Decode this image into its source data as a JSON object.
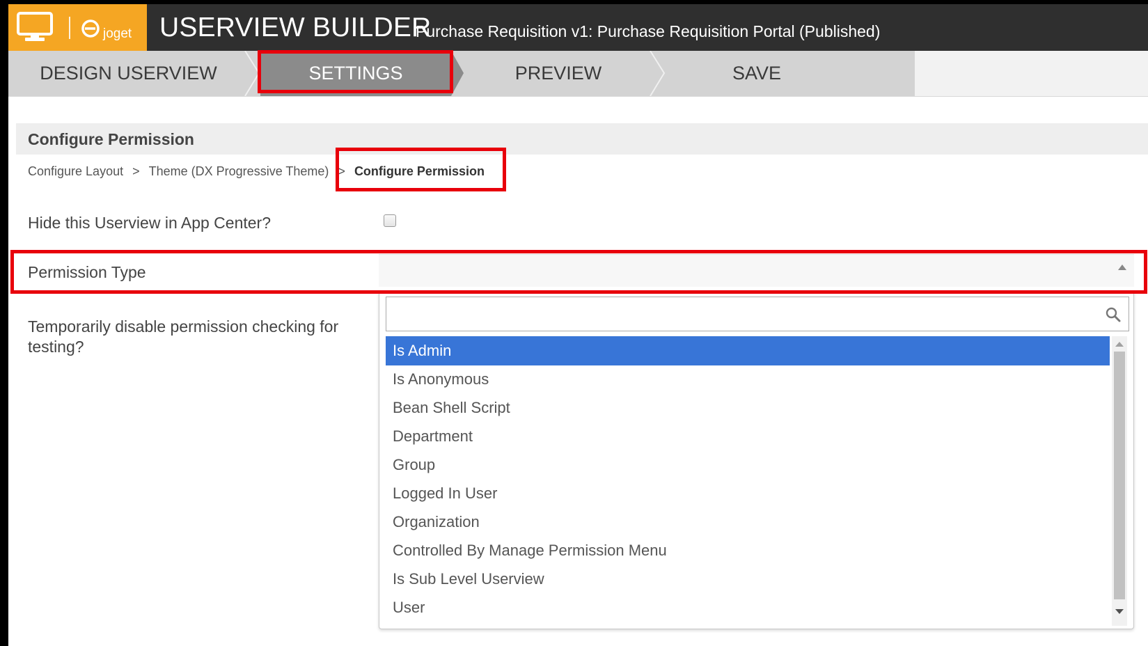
{
  "header": {
    "title": "USERVIEW BUILDER",
    "subtitle": "Purchase Requisition v1: Purchase Requisition Portal (Published)",
    "logo_text": "joget",
    "logo_color": "#f5a623",
    "bar_color": "#2f2f2f"
  },
  "tabs": [
    {
      "label": "DESIGN USERVIEW",
      "active": false
    },
    {
      "label": "SETTINGS",
      "active": true
    },
    {
      "label": "PREVIEW",
      "active": false
    },
    {
      "label": "SAVE",
      "active": false
    }
  ],
  "section": {
    "title": "Configure Permission"
  },
  "breadcrumb": {
    "items": [
      "Configure Layout",
      "Theme (DX Progressive Theme)",
      "Configure Permission"
    ],
    "separator": ">"
  },
  "fields": {
    "hide_userview": {
      "label": "Hide this Userview in App Center?",
      "checked": false
    },
    "permission_type": {
      "label": "Permission Type",
      "value": ""
    },
    "disable_permission": {
      "label": "Temporarily disable permission checking for testing?"
    }
  },
  "dropdown": {
    "search_value": "",
    "options": [
      {
        "label": "Is Admin",
        "selected": true
      },
      {
        "label": "Is Anonymous",
        "selected": false
      },
      {
        "label": "Bean Shell Script",
        "selected": false
      },
      {
        "label": "Department",
        "selected": false
      },
      {
        "label": "Group",
        "selected": false
      },
      {
        "label": "Logged In User",
        "selected": false
      },
      {
        "label": "Organization",
        "selected": false
      },
      {
        "label": "Controlled By Manage Permission Menu",
        "selected": false
      },
      {
        "label": "Is Sub Level Userview",
        "selected": false
      },
      {
        "label": "User",
        "selected": false
      }
    ],
    "selected_color": "#3875d7"
  },
  "highlight_color": "#e8000b",
  "icons": {
    "monitor": "monitor-icon",
    "logo": "joget-logo-icon",
    "search": "search-icon",
    "checkbox": "checkbox-icon"
  }
}
